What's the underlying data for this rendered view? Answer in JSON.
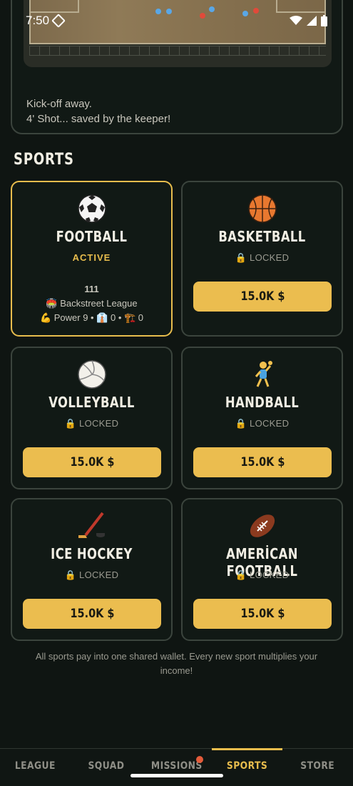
{
  "status_bar": {
    "time": "7:50"
  },
  "match": {
    "commentary": [
      "Kick-off away.",
      "4' Shot... saved by the keeper!"
    ]
  },
  "section": {
    "title": "SPORTS"
  },
  "sports": [
    {
      "emoji": "⚽",
      "name": "FOOTBALL",
      "status": "ACTIVE",
      "league_number": "111",
      "league_name": "🏟️ Backstreet League",
      "stats": "💪 Power 9 • 👔 0 • 🏗️ 0"
    },
    {
      "emoji": "🏀",
      "name": "BASKETBALL",
      "status": "🔒 LOCKED",
      "price": "15.0K $"
    },
    {
      "emoji": "🏐",
      "name": "VOLLEYBALL",
      "status": "🔒 LOCKED",
      "price": "15.0K $"
    },
    {
      "emoji": "🤾",
      "name": "HANDBALL",
      "status": "🔒 LOCKED",
      "price": "15.0K $"
    },
    {
      "emoji": "🏒",
      "name": "ICE HOCKEY",
      "status": "🔒 LOCKED",
      "price": "15.0K $"
    },
    {
      "emoji": "🏈",
      "name": "AMERİCAN FOOTBALL",
      "status": "🔒 LOCKED",
      "price": "15.0K $"
    }
  ],
  "footnote": "All sports pay into one shared wallet. Every new sport multiplies your income!",
  "nav": {
    "items": [
      "LEAGUE",
      "SQUAD",
      "MISSIONS",
      "SPORTS",
      "STORE"
    ],
    "active": "SPORTS"
  },
  "colors": {
    "accent": "#ebbd4f",
    "background": "#0f1512",
    "card_border": "#3b443d",
    "badge": "#e35b3a"
  }
}
